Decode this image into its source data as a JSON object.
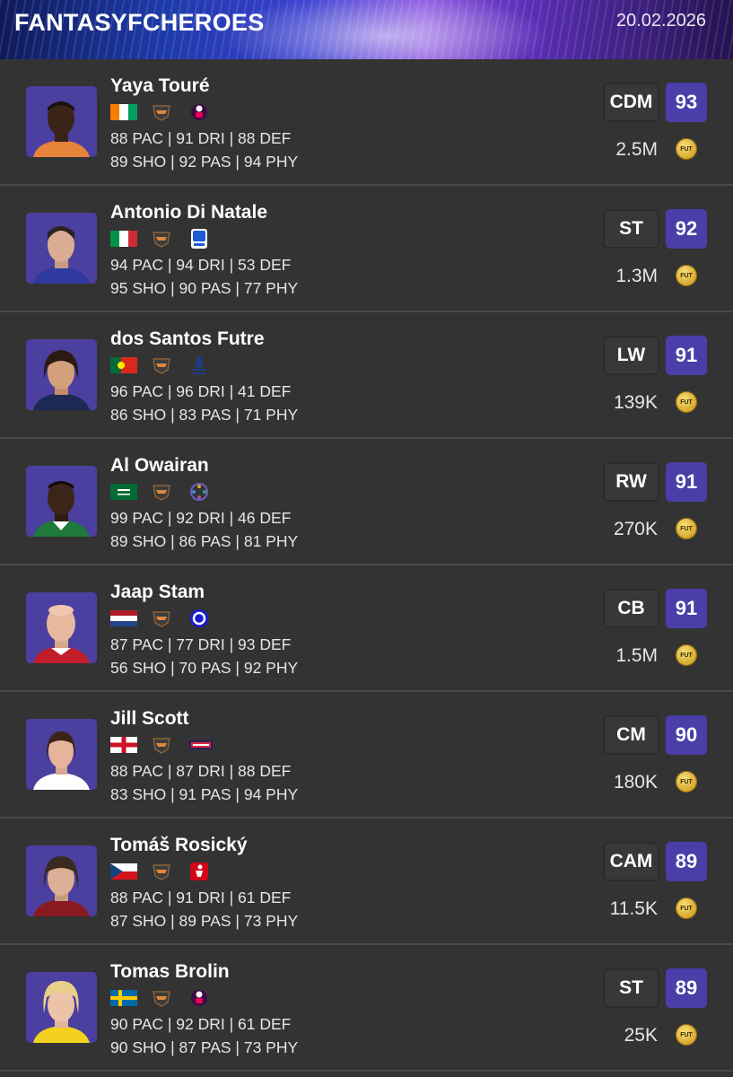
{
  "header": {
    "brand": "FANTASYFCHEROES",
    "date": "20.02.2026"
  },
  "currency_icon": "fut-coin-icon",
  "colors": {
    "rating_badge": "#4a3ea8",
    "background": "#333333",
    "row_divider": "#4a4a4a"
  },
  "players": [
    {
      "name": "Yaya Touré",
      "position": "CDM",
      "rating": "93",
      "price": "2.5M",
      "stats_line1": "88 PAC | 91 DRI | 88 DEF",
      "stats_line2": "89 SHO | 92 PAS | 94 PHY",
      "nation": "Ivory Coast",
      "league": "premier-league"
    },
    {
      "name": "Antonio Di Natale",
      "position": "ST",
      "rating": "92",
      "price": "1.3M",
      "stats_line1": "94 PAC | 94 DRI | 53 DEF",
      "stats_line2": "95 SHO | 90 PAS | 77 PHY",
      "nation": "Italy",
      "league": "serie-a"
    },
    {
      "name": "dos Santos Futre",
      "position": "LW",
      "rating": "91",
      "price": "139K",
      "stats_line1": "96 PAC | 96 DRI | 41 DEF",
      "stats_line2": "86 SHO | 83 PAS | 71 PHY",
      "nation": "Portugal",
      "league": "liga-portugal"
    },
    {
      "name": "Al Owairan",
      "position": "RW",
      "rating": "91",
      "price": "270K",
      "stats_line1": "99 PAC | 92 DRI | 46 DEF",
      "stats_line2": "89 SHO | 86 PAS | 81 PHY",
      "nation": "Saudi Arabia",
      "league": "saudi-pro-league"
    },
    {
      "name": "Jaap Stam",
      "position": "CB",
      "rating": "91",
      "price": "1.5M",
      "stats_line1": "87 PAC | 77 DRI | 93 DEF",
      "stats_line2": "56 SHO | 70 PAS | 92 PHY",
      "nation": "Netherlands",
      "league": "ligue-1"
    },
    {
      "name": "Jill Scott",
      "position": "CM",
      "rating": "90",
      "price": "180K",
      "stats_line1": "88 PAC | 87 DRI | 88 DEF",
      "stats_line2": "83 SHO | 91 PAS | 94 PHY",
      "nation": "England",
      "league": "nwsl"
    },
    {
      "name": "Tomáš Rosický",
      "position": "CAM",
      "rating": "89",
      "price": "11.5K",
      "stats_line1": "88 PAC | 91 DRI | 61 DEF",
      "stats_line2": "87 SHO | 89 PAS | 73 PHY",
      "nation": "Czech Republic",
      "league": "bundesliga"
    },
    {
      "name": "Tomas Brolin",
      "position": "ST",
      "rating": "89",
      "price": "25K",
      "stats_line1": "90 PAC | 92 DRI | 61 DEF",
      "stats_line2": "90 SHO | 87 PAS | 73 PHY",
      "nation": "Sweden",
      "league": "premier-league"
    }
  ]
}
